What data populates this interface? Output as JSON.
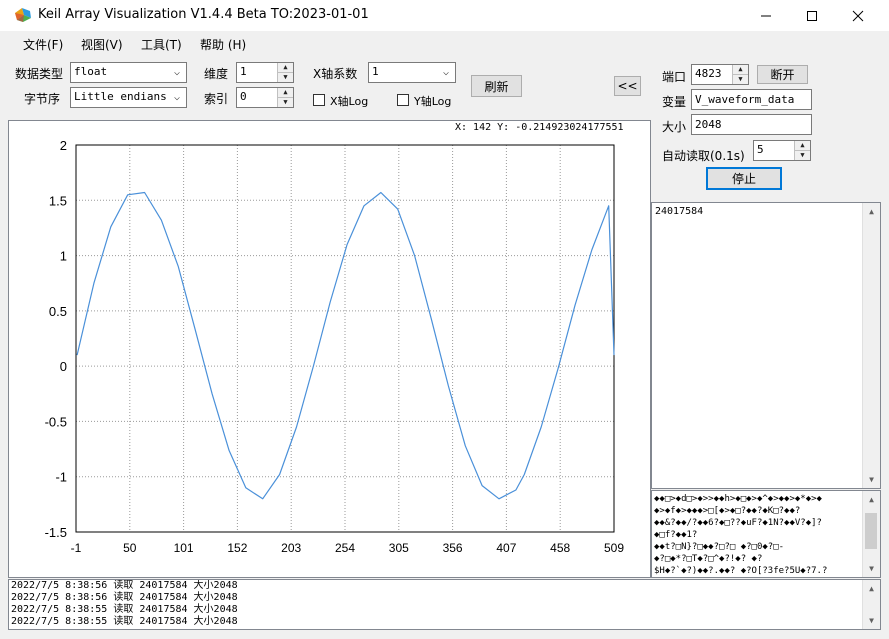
{
  "window": {
    "title": "Keil Array Visualization V1.4.4 Beta TO:2023-01-01"
  },
  "menu": [
    "文件(F)",
    "视图(V)",
    "工具(T)",
    "帮助 (H)"
  ],
  "controls": {
    "data_type_label": "数据类型",
    "data_type_value": "float",
    "byte_order_label": "字节序",
    "byte_order_value": "Little endians",
    "dimension_label": "维度",
    "dimension_value": "1",
    "index_label": "索引",
    "index_value": "0",
    "x_coef_label": "X轴系数",
    "x_coef_value": "1",
    "x_log_label": "X轴Log",
    "y_log_label": "Y轴Log",
    "refresh_label": "刷新",
    "collapse_label": "<<"
  },
  "connection": {
    "port_label": "端口",
    "port_value": "4823",
    "disconnect_label": "断开",
    "variable_label": "变量",
    "variable_value": "V_waveform_data",
    "size_label": "大小",
    "size_value": "2048",
    "auto_read_label": "自动读取(0.1s)",
    "auto_read_value": "5",
    "stop_label": "停止"
  },
  "cursor_readout": "X: 142 Y: -0.214923024177551",
  "chart_data": {
    "type": "line",
    "title": "",
    "xlabel": "",
    "ylabel": "",
    "xlim": [
      -1,
      509
    ],
    "ylim": [
      -1.5,
      2
    ],
    "x_ticks": [
      "-1",
      "50",
      "101",
      "152",
      "203",
      "254",
      "305",
      "356",
      "407",
      "458",
      "509"
    ],
    "y_ticks": [
      "2",
      "1.5",
      "1",
      "0.5",
      "0",
      "-0.5",
      "-1",
      "-1.5"
    ],
    "grid": true,
    "series": [
      {
        "color": "#4a90d9",
        "x": [
          0,
          16,
          32,
          48,
          64,
          80,
          96,
          112,
          128,
          144,
          160,
          176,
          192,
          208,
          224,
          240,
          256,
          272,
          288,
          304,
          320,
          336,
          352,
          368,
          384,
          400,
          416,
          424,
          440,
          456,
          472,
          488,
          504,
          509
        ],
        "y": [
          0.1,
          0.75,
          1.26,
          1.55,
          1.57,
          1.32,
          0.9,
          0.33,
          -0.25,
          -0.76,
          -1.1,
          -1.2,
          -0.98,
          -0.55,
          0.0,
          0.58,
          1.1,
          1.45,
          1.57,
          1.42,
          1.0,
          0.42,
          -0.18,
          -0.72,
          -1.08,
          -1.2,
          -1.12,
          -0.98,
          -0.55,
          -0.02,
          0.55,
          1.05,
          1.45,
          0.1
        ]
      }
    ]
  },
  "memo_top": {
    "text": "24017584"
  },
  "memo_bottom": {
    "lines": [
      "◆◆□>◆d□>◆>>◆◆h>◆□◆>◆^◆>◆◆>◆*◆>◆",
      "◆>◆f◆>◆◆◆>□[◆>◆□?◆◆?◆K□?◆◆?",
      "◆◆&?◆◆/?◆◆6?◆□??◆uF?◆1N?◆◆V?◆]?",
      "◆□f?◆◆1?",
      "◆◆t?□N}?□◆◆?□?□ ◆?□0◆?□-",
      "◆?□◆*?□T◆?□^◆?!◆? ◆?",
      "$H◆?`◆?)◆◆?.◆◆? ◆?O[?3fe?5U◆?7.?"
    ]
  },
  "log": {
    "lines": [
      "2022/7/5 8:38:56 读取 24017584 大小2048",
      "2022/7/5 8:38:56 读取 24017584 大小2048",
      "2022/7/5 8:38:55 读取 24017584 大小2048",
      "2022/7/5 8:38:55 读取 24017584 大小2048"
    ]
  }
}
